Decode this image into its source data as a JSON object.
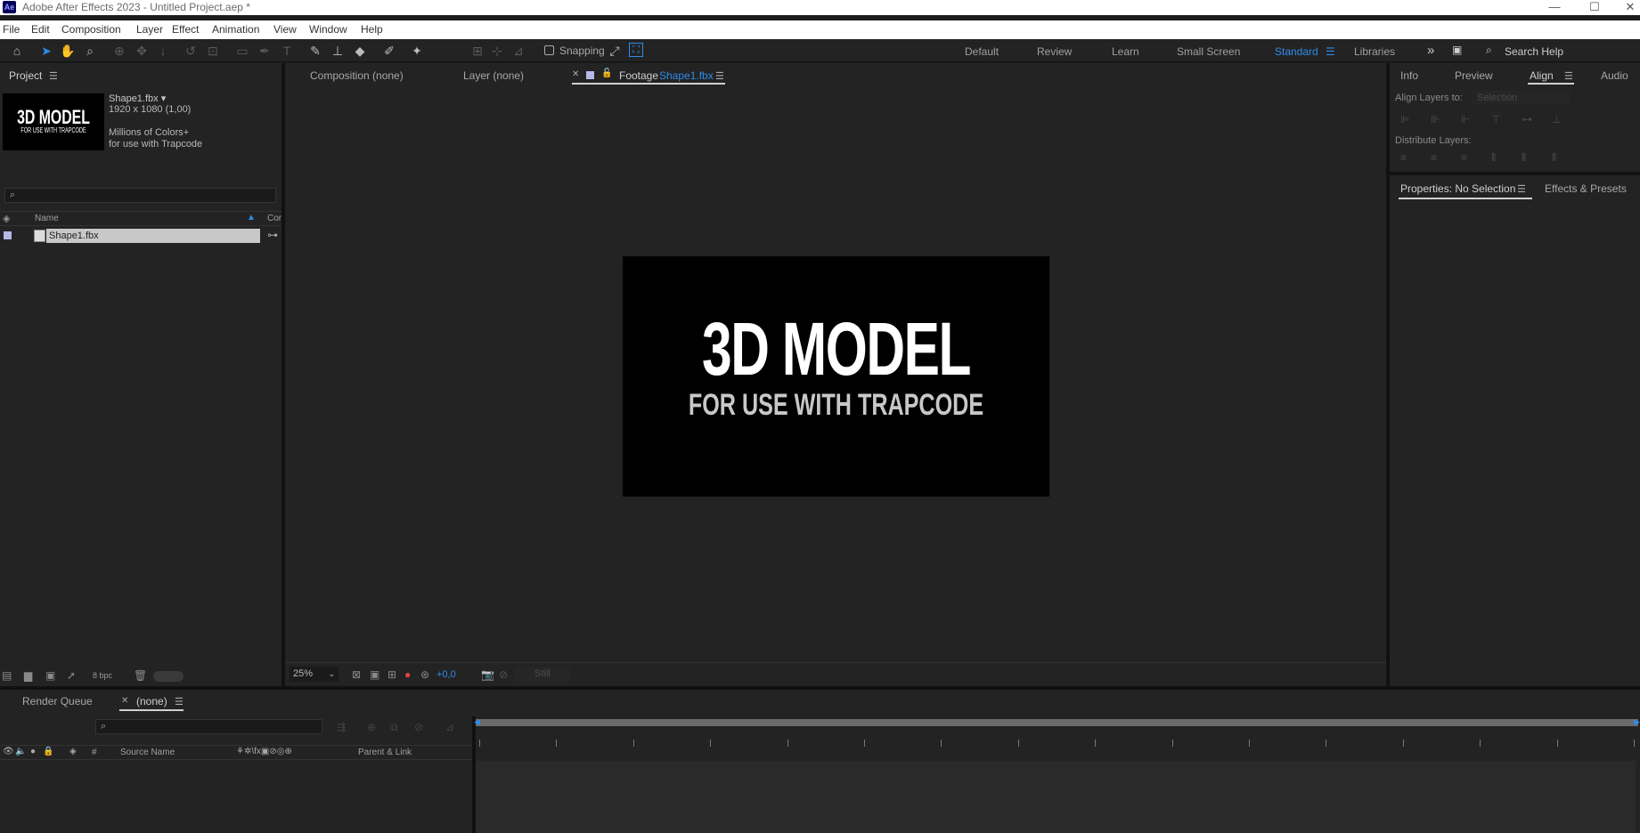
{
  "window": {
    "title": "Adobe After Effects 2023 - Untitled Project.aep *",
    "logo": "Ae",
    "minimize": "—",
    "maximize": "☐",
    "close": "✕"
  },
  "menu": [
    "File",
    "Edit",
    "Composition",
    "Layer",
    "Effect",
    "Animation",
    "View",
    "Window",
    "Help"
  ],
  "toolbar": {
    "snapping_label": "Snapping",
    "workspaces": [
      "Default",
      "Review",
      "Learn",
      "Small Screen",
      "Standard",
      "Libraries"
    ],
    "active_workspace": "Standard",
    "more": "»",
    "search_help": "Search Help"
  },
  "project_panel": {
    "tab": "Project",
    "item_name": "Shape1.fbx ▾",
    "item_dims": "1920 x 1080 (1,00)",
    "item_colors": "Millions of Colors+",
    "item_comment": "for use with Trapcode",
    "thumb_line1": "3D MODEL",
    "thumb_line2": "FOR USE WITH TRAPCODE",
    "col_name": "Name",
    "col_comment": "Com",
    "rows": [
      {
        "name": "Shape1.fbx"
      }
    ],
    "bpc": "8 bpc"
  },
  "viewer": {
    "tabs": {
      "composition": "Composition (none)",
      "layer": "Layer (none)",
      "footage_prefix": "Footage",
      "footage_name": "Shape1.fbx"
    },
    "footage_line1": "3D MODEL",
    "footage_line2": "FOR USE WITH TRAPCODE",
    "zoom": "25%",
    "exposure": "+0,0",
    "still": "Still"
  },
  "right_panel": {
    "tabs": [
      "Info",
      "Preview",
      "Align",
      "Audio"
    ],
    "active_tab": "Align",
    "align_layers_to": "Align Layers to:",
    "align_select": "Selection",
    "distribute_layers": "Distribute Layers:",
    "props_tab": "Properties: No Selection",
    "effects_tab": "Effects & Presets"
  },
  "timeline": {
    "render_queue": "Render Queue",
    "comp_tab": "(none)",
    "col_hash": "#",
    "col_source": "Source Name",
    "col_parent": "Parent & Link"
  }
}
